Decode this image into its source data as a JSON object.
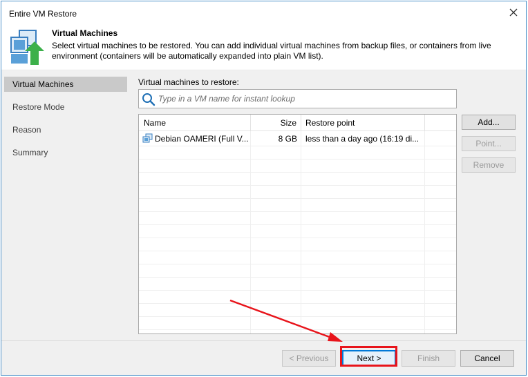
{
  "window": {
    "title": "Entire VM Restore"
  },
  "header": {
    "title": "Virtual Machines",
    "description": "Select virtual machines to be restored. You can add individual virtual machines from backup files, or containers from live environment (containers will be automatically expanded into plain VM list)."
  },
  "sidebar": {
    "items": [
      {
        "label": "Virtual Machines",
        "active": true
      },
      {
        "label": "Restore Mode",
        "active": false
      },
      {
        "label": "Reason",
        "active": false
      },
      {
        "label": "Summary",
        "active": false
      }
    ]
  },
  "content": {
    "label": "Virtual machines to restore:",
    "search": {
      "placeholder": "Type in a VM name for instant lookup",
      "value": ""
    },
    "grid": {
      "columns": [
        "Name",
        "Size",
        "Restore point"
      ],
      "rows": [
        {
          "name": "Debian OAMERI (Full V...",
          "size": "8 GB",
          "restore_point": "less than a day ago (16:19 di..."
        }
      ]
    },
    "buttons": {
      "add": "Add...",
      "point": "Point...",
      "remove": "Remove"
    }
  },
  "footer": {
    "previous": "< Previous",
    "next": "Next >",
    "finish": "Finish",
    "cancel": "Cancel"
  },
  "colors": {
    "accent": "#0078d7",
    "highlight": "#e8141b",
    "icon_green": "#3cb04a",
    "icon_blue": "#5aa0d8"
  }
}
